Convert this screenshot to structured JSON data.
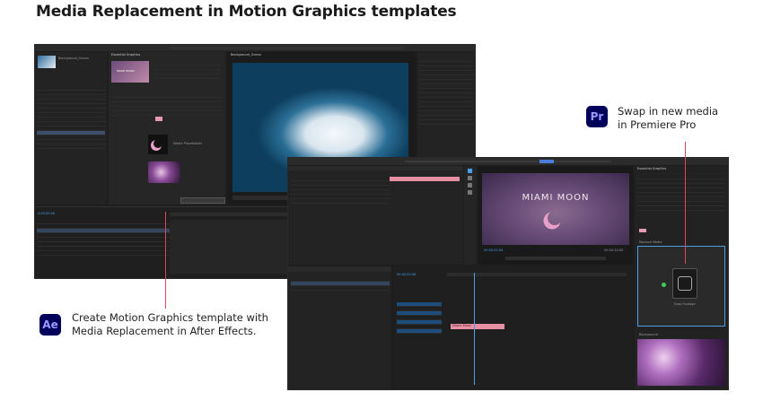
{
  "title": "Media Replacement in Motion Graphics templates",
  "ae_badge": "Ae",
  "pr_badge": "Pr",
  "ae_caption": [
    "Create Motion Graphics template with",
    "Media Replacement in After Effects."
  ],
  "pr_caption": [
    "Swap in new media",
    "in Premiere Pro"
  ],
  "pr_preview_title": "MIAMI MOON",
  "ae_thumb_title": "MIAMI MOON",
  "ae_ui": {
    "essential_graphics": "Essential Graphics",
    "media_label": "Media Placeholder",
    "timecode": "0:00:00:00",
    "preview_label": "Background_Ocean"
  },
  "pr_ui": {
    "timecode_left": "00:00:02:06",
    "timecode_right": "00:00:10:00",
    "timeline_timecode": "00:00:02:06",
    "essential_graphics": "Essential Graphics",
    "replace_media": "Replace Media",
    "drop_label": "Drop Footage",
    "background_label": "Background",
    "clip_label": "Miami Moon"
  },
  "colors": {
    "accent_line": "#e0445a",
    "clip_pink": "#e88fa3",
    "app_dark": "#1e1e1e",
    "badge_bg": "#00005b",
    "badge_fg": "#9999ff"
  }
}
